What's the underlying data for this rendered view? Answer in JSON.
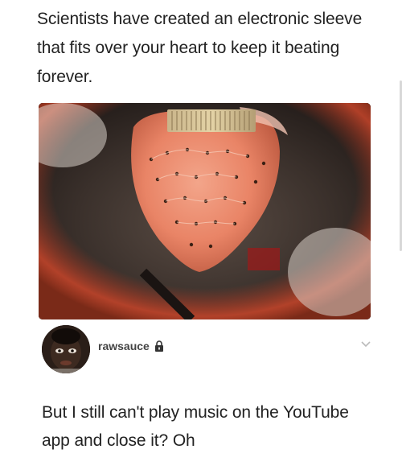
{
  "post": {
    "headline": "Scientists have created an electronic sleeve that fits over your heart to keep it beating forever."
  },
  "author": {
    "username": "rawsauce",
    "lock_icon": "lock-icon",
    "menu_icon": "chevron-down-icon"
  },
  "reply": {
    "text": "But I still can't play music on the YouTube app and close it? Oh"
  },
  "colors": {
    "text": "#222222",
    "username": "#444444",
    "chevron": "#bbbbbb"
  }
}
